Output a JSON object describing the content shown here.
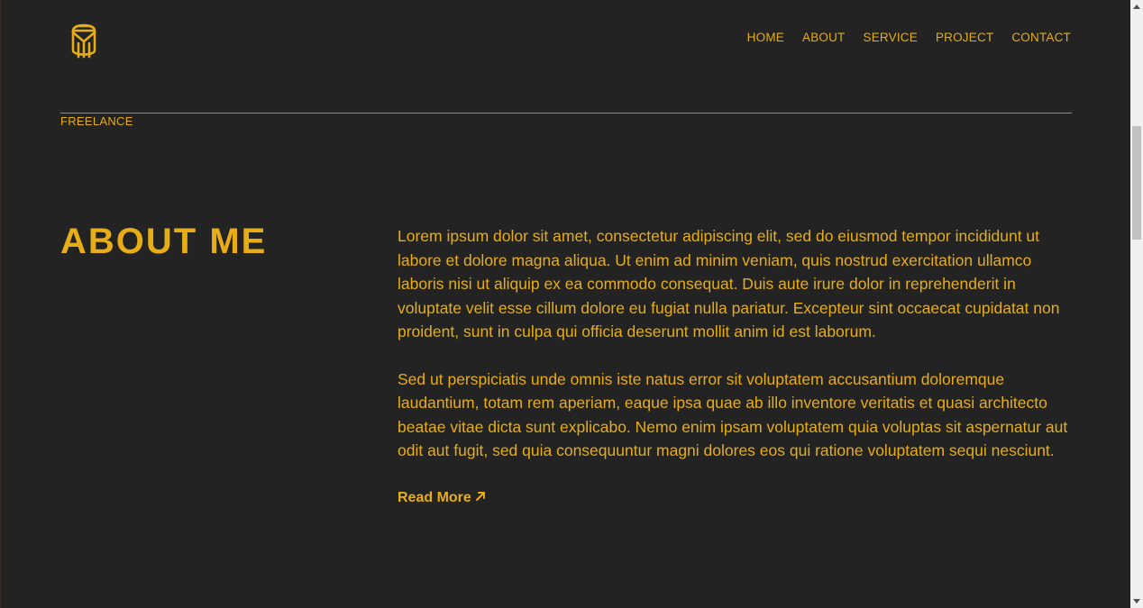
{
  "header": {
    "logo_icon": "monogram-logo-icon",
    "nav": [
      {
        "label": "HOME"
      },
      {
        "label": "ABOUT"
      },
      {
        "label": "SERVICE"
      },
      {
        "label": "PROJECT"
      },
      {
        "label": "CONTACT"
      }
    ]
  },
  "hero": {
    "tag": "FREELANCE"
  },
  "about": {
    "title": "ABOUT ME",
    "paragraph_1": "Lorem ipsum dolor sit amet, consectetur adipiscing elit, sed do eiusmod tempor incididunt ut labore et dolore magna aliqua. Ut enim ad minim veniam, quis nostrud exercitation ullamco laboris nisi ut aliquip ex ea commodo consequat. Duis aute irure dolor in reprehenderit in voluptate velit esse cillum dolore eu fugiat nulla pariatur. Excepteur sint occaecat cupidatat non proident, sunt in culpa qui officia deserunt mollit anim id est laborum.",
    "paragraph_2": "Sed ut perspiciatis unde omnis iste natus error sit voluptatem accusantium doloremque laudantium, totam rem aperiam, eaque ipsa quae ab illo inventore veritatis et quasi architecto beatae vitae dicta sunt explicabo. Nemo enim ipsam voluptatem quia voluptas sit aspernatur aut odit aut fugit, sed quia consequuntur magni dolores eos qui ratione voluptatem sequi nesciunt.",
    "read_more_label": "Read More",
    "read_more_icon": "arrow-up-right-icon"
  },
  "colors": {
    "background": "#232323",
    "accent": "#e6ad16"
  }
}
